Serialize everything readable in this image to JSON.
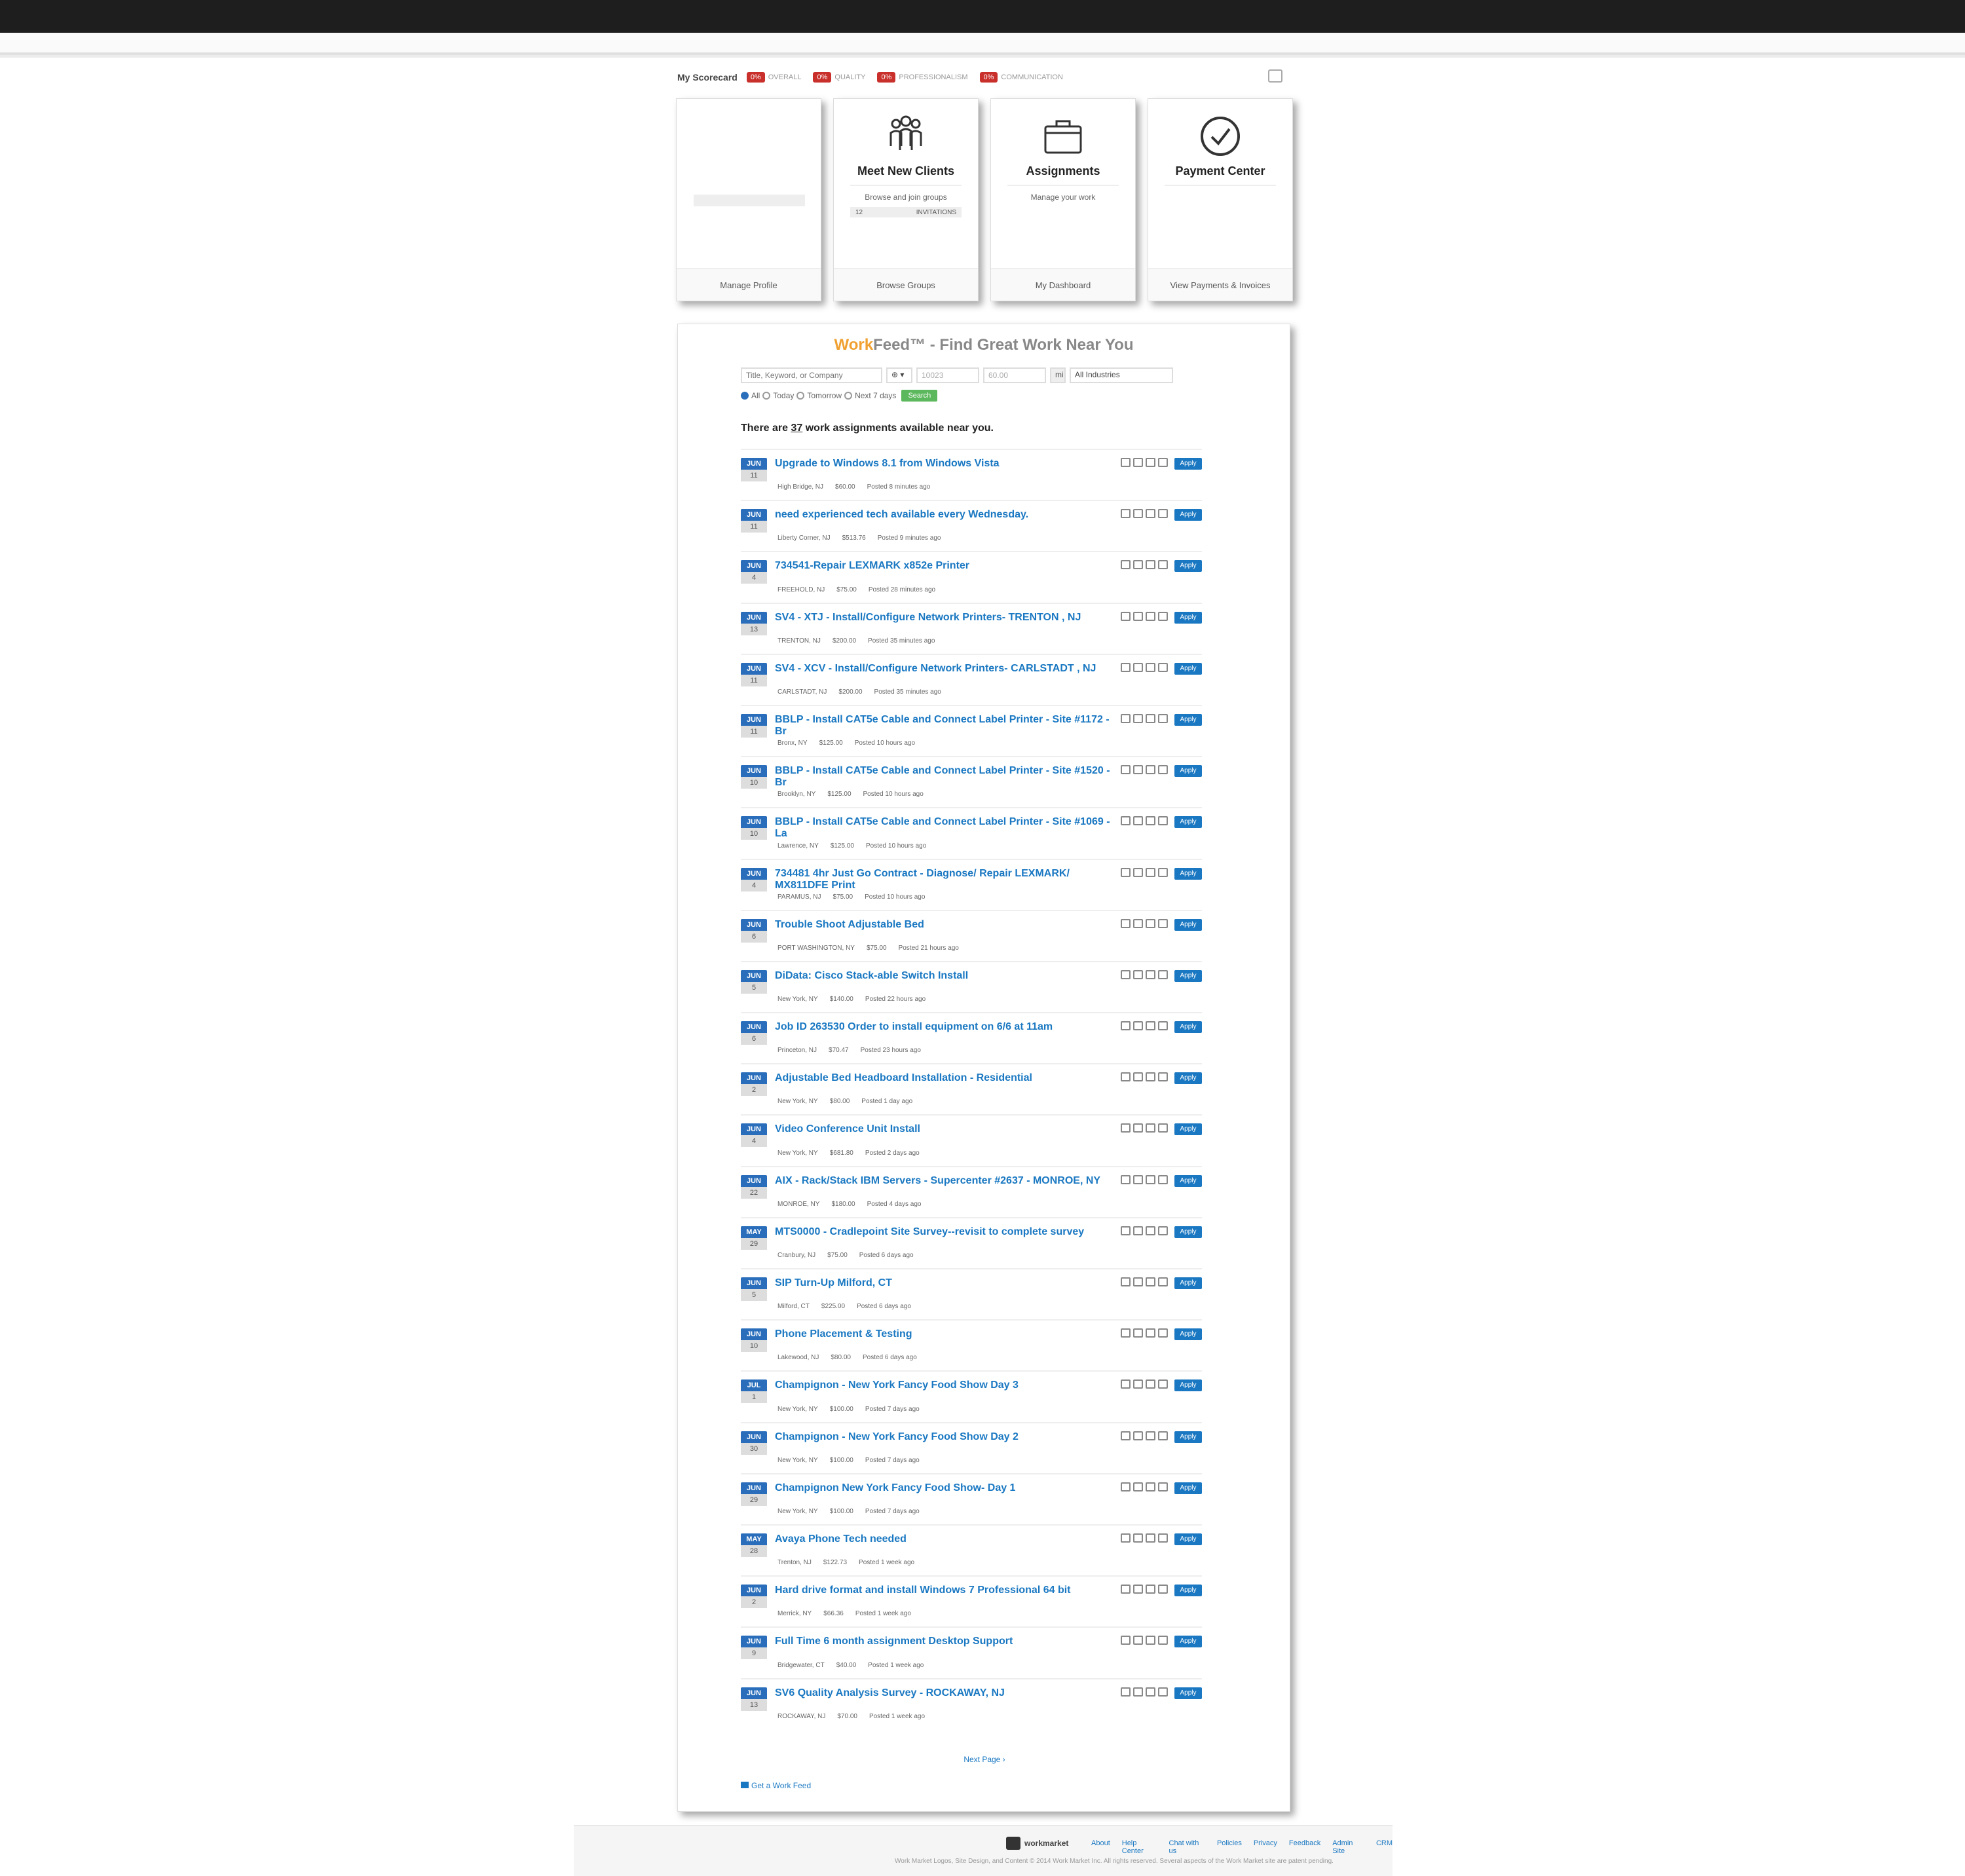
{
  "scorecard": {
    "title": "My Scorecard",
    "items": [
      {
        "badge": "0%",
        "label": "OVERALL"
      },
      {
        "badge": "0%",
        "label": "QUALITY"
      },
      {
        "badge": "0%",
        "label": "PROFESSIONALISM"
      },
      {
        "badge": "0%",
        "label": "COMMUNICATION"
      }
    ]
  },
  "cards": [
    {
      "title": "",
      "desc": "",
      "footer": "Manage Profile"
    },
    {
      "title": "Meet New Clients",
      "desc": "Browse and join groups",
      "bar_count": "12",
      "bar_label": "INVITATIONS",
      "footer": "Browse Groups"
    },
    {
      "title": "Assignments",
      "desc": "Manage your work",
      "footer": "My Dashboard"
    },
    {
      "title": "Payment Center",
      "desc": "",
      "footer": "View Payments & Invoices"
    }
  ],
  "feed": {
    "title_work": "Work",
    "title_rest": "Feed™ - Find Great Work Near You",
    "keyword_placeholder": "Title, Keyword, or Company",
    "distance_select": "⊕ ▾",
    "zip_value": "10023",
    "amount_value": "60.00",
    "mi_label": "mi",
    "industry_select": "All Industries",
    "radios": [
      "All",
      "Today",
      "Tomorrow",
      "Next 7 days"
    ],
    "go_label": "Search",
    "count_prefix": "There are ",
    "count": "37",
    "count_suffix": " work assignments available near you.",
    "next_page": "Next Page ›",
    "get_feed": "Get a Work Feed"
  },
  "jobs": [
    {
      "mon": "JUN",
      "day": "11",
      "title": "Upgrade to Windows 8.1 from Windows Vista",
      "loc": "High Bridge, NJ",
      "price": "$60.00",
      "posted": "Posted 8 minutes ago"
    },
    {
      "mon": "JUN",
      "day": "11",
      "title": "need experienced tech available every Wednesday.",
      "loc": "Liberty Corner, NJ",
      "price": "$513.76",
      "posted": "Posted 9 minutes ago"
    },
    {
      "mon": "JUN",
      "day": "4",
      "title": "734541-Repair LEXMARK x852e Printer",
      "loc": "FREEHOLD, NJ",
      "price": "$75.00",
      "posted": "Posted 28 minutes ago"
    },
    {
      "mon": "JUN",
      "day": "13",
      "title": "SV4 - XTJ - Install/Configure Network Printers- TRENTON , NJ",
      "loc": "TRENTON, NJ",
      "price": "$200.00",
      "posted": "Posted 35 minutes ago"
    },
    {
      "mon": "JUN",
      "day": "11",
      "title": "SV4 - XCV - Install/Configure Network Printers- CARLSTADT , NJ",
      "loc": "CARLSTADT, NJ",
      "price": "$200.00",
      "posted": "Posted 35 minutes ago"
    },
    {
      "mon": "JUN",
      "day": "11",
      "title": "BBLP - Install CAT5e Cable and Connect Label Printer - Site #1172 - Br",
      "loc": "Bronx, NY",
      "price": "$125.00",
      "posted": "Posted 10 hours ago"
    },
    {
      "mon": "JUN",
      "day": "10",
      "title": "BBLP - Install CAT5e Cable and Connect Label Printer - Site #1520 - Br",
      "loc": "Brooklyn, NY",
      "price": "$125.00",
      "posted": "Posted 10 hours ago"
    },
    {
      "mon": "JUN",
      "day": "10",
      "title": "BBLP - Install CAT5e Cable and Connect Label Printer - Site #1069 - La",
      "loc": "Lawrence, NY",
      "price": "$125.00",
      "posted": "Posted 10 hours ago"
    },
    {
      "mon": "JUN",
      "day": "4",
      "title": "734481 4hr Just Go Contract - Diagnose/ Repair LEXMARK/ MX811DFE Print",
      "loc": "PARAMUS, NJ",
      "price": "$75.00",
      "posted": "Posted 10 hours ago"
    },
    {
      "mon": "JUN",
      "day": "6",
      "title": "Trouble Shoot Adjustable Bed",
      "loc": "PORT WASHINGTON, NY",
      "price": "$75.00",
      "posted": "Posted 21 hours ago"
    },
    {
      "mon": "JUN",
      "day": "5",
      "title": "DiData: Cisco Stack-able Switch Install",
      "loc": "New York, NY",
      "price": "$140.00",
      "posted": "Posted 22 hours ago"
    },
    {
      "mon": "JUN",
      "day": "6",
      "title": "Job ID 263530 Order to install equipment on 6/6 at 11am",
      "loc": "Princeton, NJ",
      "price": "$70.47",
      "posted": "Posted 23 hours ago"
    },
    {
      "mon": "JUN",
      "day": "2",
      "title": "Adjustable Bed Headboard Installation - Residential",
      "loc": "New York, NY",
      "price": "$80.00",
      "posted": "Posted 1 day ago"
    },
    {
      "mon": "JUN",
      "day": "4",
      "title": "Video Conference Unit Install",
      "loc": "New York, NY",
      "price": "$681.80",
      "posted": "Posted 2 days ago"
    },
    {
      "mon": "JUN",
      "day": "22",
      "title": "AIX - Rack/Stack IBM Servers - Supercenter #2637 - MONROE, NY",
      "loc": "MONROE, NY",
      "price": "$180.00",
      "posted": "Posted 4 days ago"
    },
    {
      "mon": "MAY",
      "day": "29",
      "title": "MTS0000 - Cradlepoint Site Survey--revisit to complete survey",
      "loc": "Cranbury, NJ",
      "price": "$75.00",
      "posted": "Posted 6 days ago"
    },
    {
      "mon": "JUN",
      "day": "5",
      "title": "SIP Turn-Up Milford, CT",
      "loc": "Milford, CT",
      "price": "$225.00",
      "posted": "Posted 6 days ago"
    },
    {
      "mon": "JUN",
      "day": "10",
      "title": "Phone Placement & Testing",
      "loc": "Lakewood, NJ",
      "price": "$80.00",
      "posted": "Posted 6 days ago"
    },
    {
      "mon": "JUL",
      "day": "1",
      "title": "Champignon - New York Fancy Food Show Day 3",
      "loc": "New York, NY",
      "price": "$100.00",
      "posted": "Posted 7 days ago"
    },
    {
      "mon": "JUN",
      "day": "30",
      "title": "Champignon - New York Fancy Food Show Day 2",
      "loc": "New York, NY",
      "price": "$100.00",
      "posted": "Posted 7 days ago"
    },
    {
      "mon": "JUN",
      "day": "29",
      "title": "Champignon New York Fancy Food Show- Day 1",
      "loc": "New York, NY",
      "price": "$100.00",
      "posted": "Posted 7 days ago"
    },
    {
      "mon": "MAY",
      "day": "28",
      "title": "Avaya Phone Tech needed",
      "loc": "Trenton, NJ",
      "price": "$122.73",
      "posted": "Posted 1 week ago"
    },
    {
      "mon": "JUN",
      "day": "2",
      "title": "Hard drive format and install Windows 7 Professional 64 bit",
      "loc": "Merrick, NY",
      "price": "$66.36",
      "posted": "Posted 1 week ago"
    },
    {
      "mon": "JUN",
      "day": "9",
      "title": "Full Time 6 month assignment Desktop Support",
      "loc": "Bridgewater, CT",
      "price": "$40.00",
      "posted": "Posted 1 week ago"
    },
    {
      "mon": "JUN",
      "day": "13",
      "title": "SV6 Quality Analysis Survey - ROCKAWAY, NJ",
      "loc": "ROCKAWAY, NJ",
      "price": "$70.00",
      "posted": "Posted 1 week ago"
    }
  ],
  "apply_label": "Apply",
  "footer": {
    "logo": "workmarket",
    "links": [
      "About",
      "Help Center",
      "Chat with us",
      "Policies",
      "Privacy",
      "Feedback",
      "Admin Site",
      "CRM"
    ],
    "copyright": "Work Market Logos, Site Design, and Content © 2014 Work Market Inc. All rights reserved. Several aspects of the Work Market site are patent pending."
  }
}
